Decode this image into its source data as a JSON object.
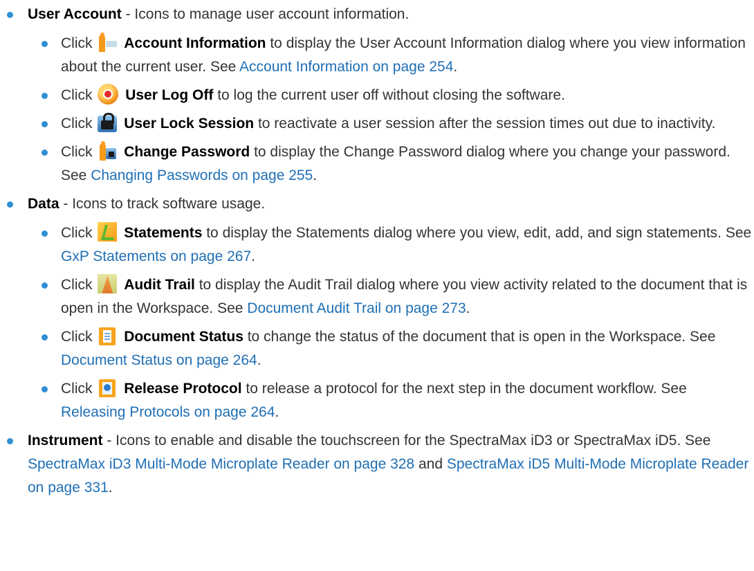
{
  "accent_color": "#2f8fd5",
  "link_color": "#1f6fb5",
  "sections": [
    {
      "term": "User Account",
      "desc": " - Icons to manage user account information.",
      "items": [
        {
          "icon": "account-information-icon",
          "term": "Account Information",
          "text": " to display the User Account Information dialog where you view information about the current user. See ",
          "link": "Account Information on page 254",
          "tail": "."
        },
        {
          "icon": "user-log-off-icon",
          "term": "User Log Off",
          "text": " to log the current user off without closing the software.",
          "link": "",
          "tail": ""
        },
        {
          "icon": "user-lock-session-icon",
          "term": "User Lock Session",
          "text": " to reactivate a user session after the session times out due to inactivity.",
          "link": "",
          "tail": ""
        },
        {
          "icon": "change-password-icon",
          "term": "Change Password",
          "text": " to display the Change Password dialog where you change your password. See ",
          "link": "Changing Passwords on page 255",
          "tail": "."
        }
      ]
    },
    {
      "term": "Data",
      "desc": " - Icons to track software usage.",
      "items": [
        {
          "icon": "statements-icon",
          "term": "Statements",
          "text": " to display the Statements dialog where you view, edit, add, and sign statements. See ",
          "link": "GxP Statements on page 267",
          "tail": "."
        },
        {
          "icon": "audit-trail-icon",
          "term": "Audit Trail",
          "text": " to display the Audit Trail dialog where you view activity related to the document that is open in the Workspace. See ",
          "link": "Document Audit Trail on page 273",
          "tail": "."
        },
        {
          "icon": "document-status-icon",
          "term": "Document Status",
          "text": " to change the status of the document that is open in the Workspace. See ",
          "link": "Document Status on page 264",
          "tail": "."
        },
        {
          "icon": "release-protocol-icon",
          "term": "Release Protocol",
          "text": " to release a protocol for the next step in the document workflow. See ",
          "link": "Releasing Protocols on page 264",
          "tail": "."
        }
      ]
    },
    {
      "term": "Instrument",
      "desc": " - Icons to enable and disable the touchscreen for the SpectraMax iD3 or SpectraMax iD5. See ",
      "link1": "SpectraMax iD3 Multi-Mode Microplate Reader on page 328",
      "and": " and ",
      "link2": "SpectraMax iD5 Multi-Mode Microplate Reader on page 331",
      "tail": "."
    }
  ],
  "click_word": "Click"
}
